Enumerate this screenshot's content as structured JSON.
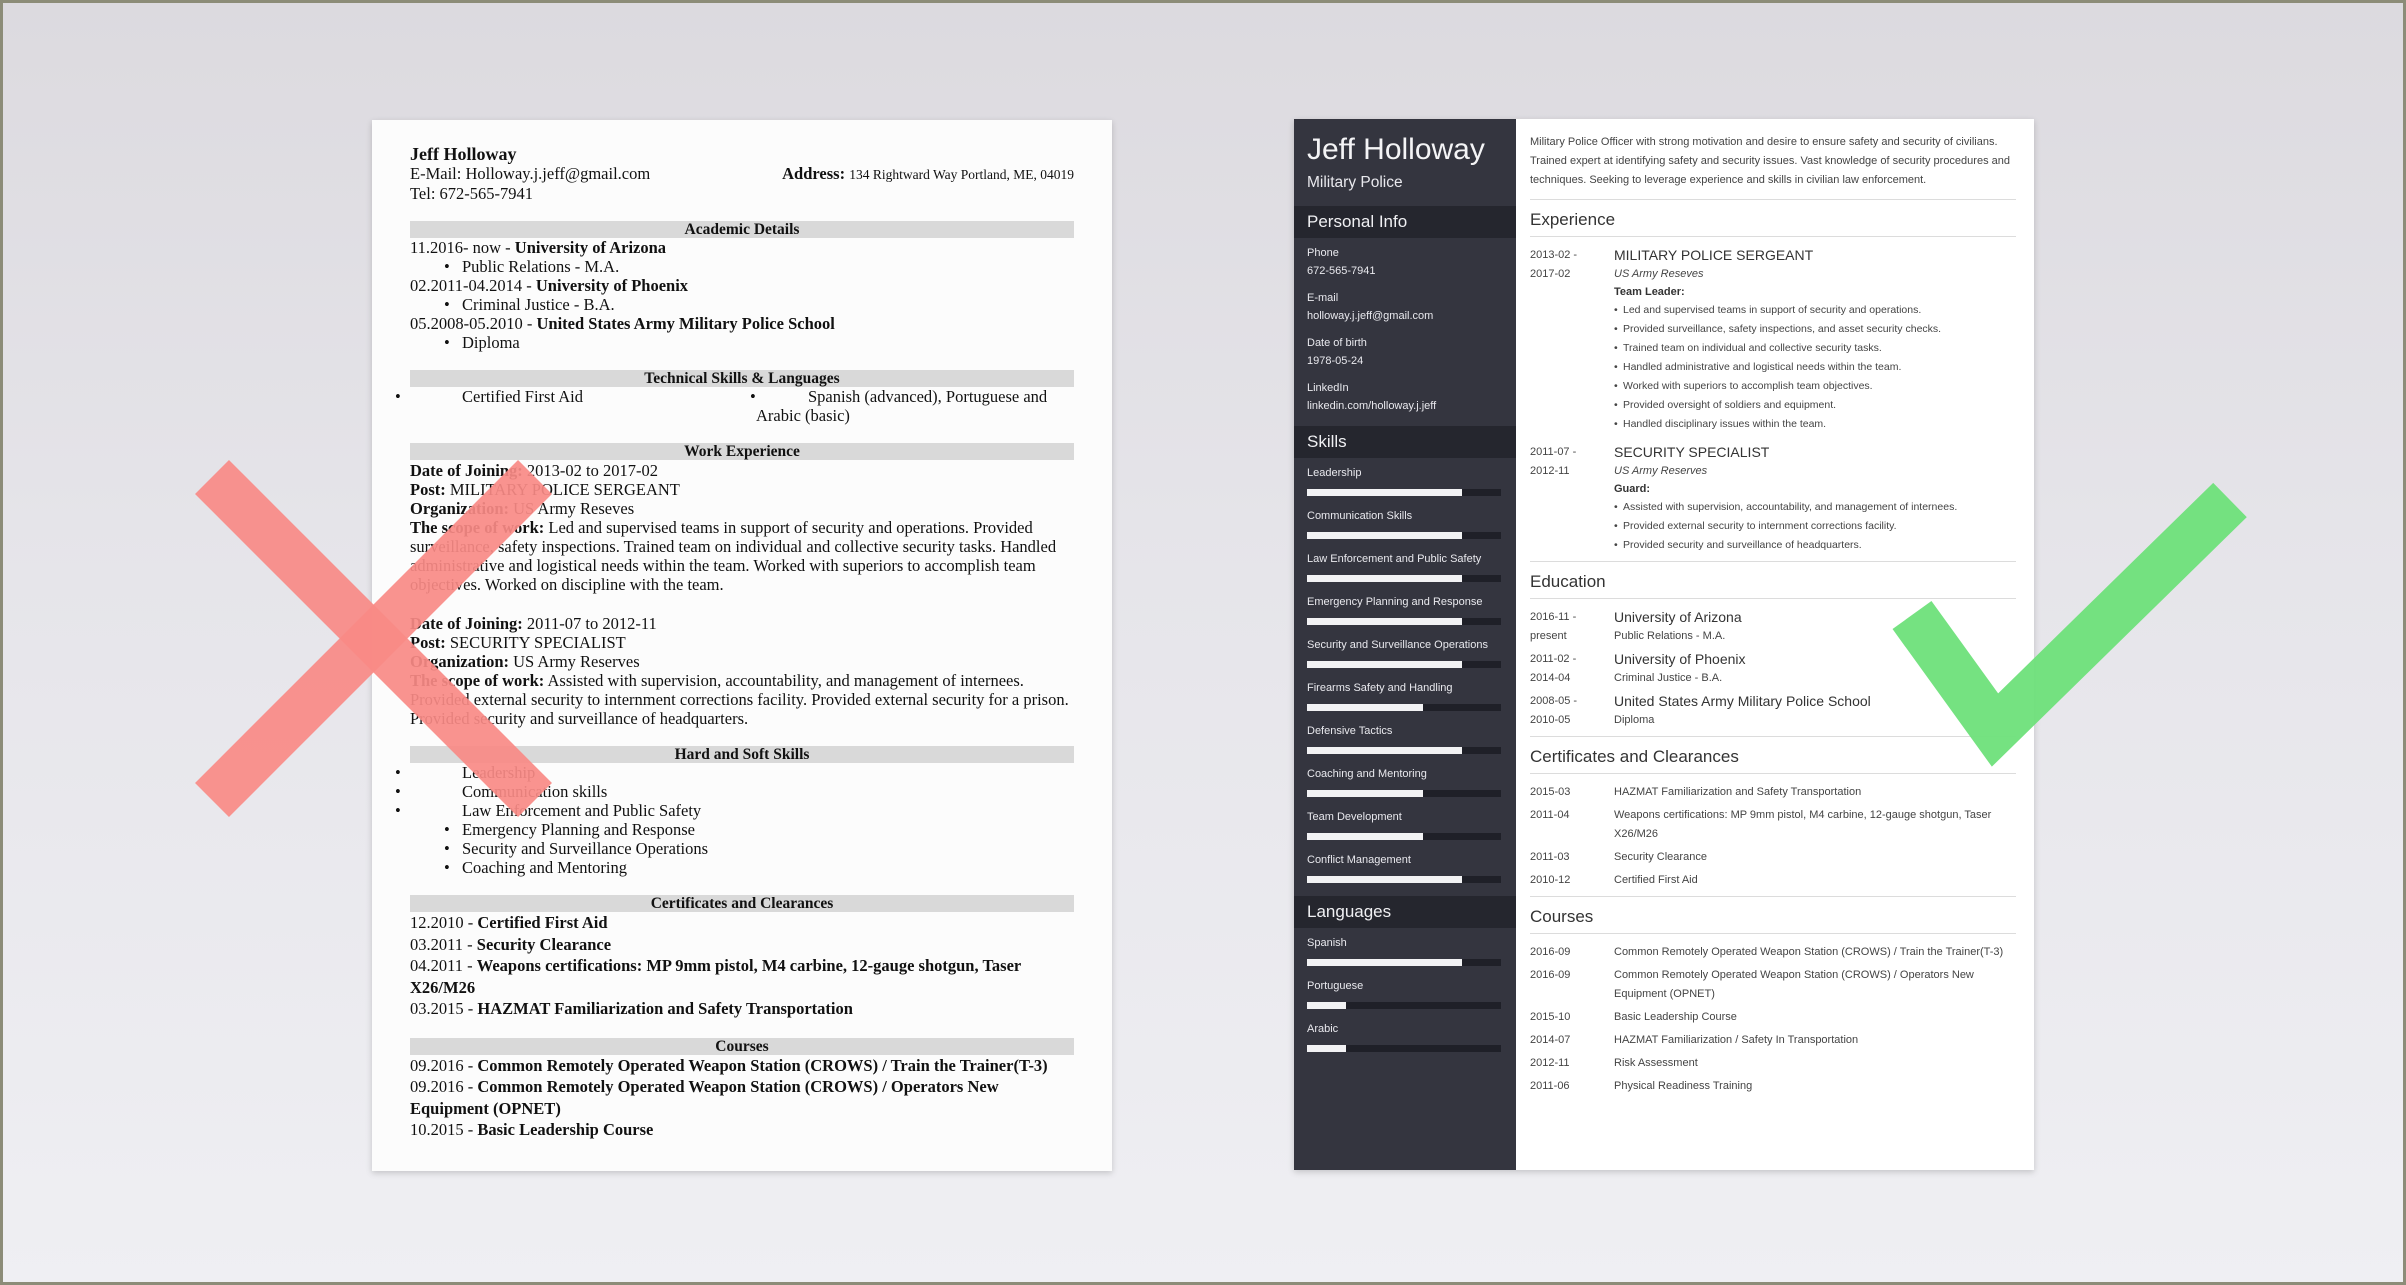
{
  "bad_resume": {
    "name": "Jeff Holloway",
    "email_line": "E-Mail: Holloway.j.jeff@gmail.com",
    "address_label": "Address:",
    "address_value": "134 Rightward Way Portland, ME, 04019",
    "tel_line": "Tel: 672-565-7941",
    "sections": {
      "academic": "Academic Details",
      "technical": "Technical Skills & Languages",
      "work": "Work Experience",
      "skills": "Hard and Soft Skills",
      "certificates": "Certificates and Clearances",
      "courses": "Courses"
    },
    "academic": [
      {
        "date": " 11.2016- now - ",
        "school": "University of Arizona",
        "degree": "Public Relations - M.A."
      },
      {
        "date": "02.2011-04.2014 - ",
        "school": "University of Phoenix",
        "degree": "Criminal Justice - B.A."
      },
      {
        "date": "05.2008-05.2010 - ",
        "school": "United States Army Military Police School",
        "degree": "Diploma"
      }
    ],
    "technical": [
      "Certified First Aid",
      "Spanish (advanced), Portuguese and Arabic (basic)"
    ],
    "labels": {
      "joining": "Date of Joining:",
      "post": "Post:",
      "organization": "Organization:",
      "scope": "The scope of work:"
    },
    "jobs": [
      {
        "dates": " 2013-02 to 2017-02",
        "post": " MILITARY POLICE SERGEANT",
        "organization": " US Army Reseves",
        "scope": " Led and supervised teams in support of security and operations. Provided surveillance, safety inspections. Trained team on individual and collective security tasks. Handled administrative and logistical needs within the team. Worked with superiors to accomplish team objectives. Worked on discipline with the team."
      },
      {
        "dates": " 2011-07 to 2012-11",
        "post": " SECURITY SPECIALIST",
        "organization": " US Army Reserves",
        "scope": " Assisted with supervision, accountability, and management of internees. Provided external security to internment corrections facility. Provided external security for a prison. Provided security and surveillance of headquarters."
      }
    ],
    "skills_far": [
      "Leadership",
      "Communication skills",
      "Law Enforcement and Public Safety"
    ],
    "skills_near": [
      "Emergency Planning and Response",
      "Security and Surveillance Operations",
      "Coaching and Mentoring"
    ],
    "certificates": [
      {
        "date": "12.2010 - ",
        "name": "Certified First Aid"
      },
      {
        "date": "03.2011 - ",
        "name": "Security Clearance"
      },
      {
        "date": "04.2011 - ",
        "name": "Weapons certifications: MP 9mm pistol, M4 carbine, 12-gauge shotgun, Taser X26/M26"
      },
      {
        "date": "03.2015 - ",
        "name": "HAZMAT Familiarization and Safety Transportation"
      }
    ],
    "courses": [
      {
        "date": "09.2016 - ",
        "name": "Common Remotely Operated Weapon Station (CROWS) / Train the Trainer(T-3)"
      },
      {
        "date": "09.2016 - ",
        "name": "Common Remotely Operated Weapon Station (CROWS) / Operators New Equipment (OPNET)"
      },
      {
        "date": "10.2015 - ",
        "name": "Basic Leadership Course"
      }
    ]
  },
  "good_resume": {
    "name": "Jeff Holloway",
    "role": "Military Police",
    "sidebar_sections": {
      "personal": "Personal Info",
      "skills": "Skills",
      "languages": "Languages"
    },
    "personal": [
      {
        "label": "Phone",
        "value": "672-565-7941"
      },
      {
        "label": "E-mail",
        "value": "holloway.j.jeff@gmail.com"
      },
      {
        "label": "Date of birth",
        "value": "1978-05-24"
      },
      {
        "label": "LinkedIn",
        "value": "linkedin.com/holloway.j.jeff"
      }
    ],
    "skills": [
      {
        "name": "Leadership",
        "level": 0.8
      },
      {
        "name": "Communication Skills",
        "level": 0.8
      },
      {
        "name": "Law Enforcement and Public Safety",
        "level": 0.8
      },
      {
        "name": "Emergency Planning and Response",
        "level": 0.8
      },
      {
        "name": "Security and Surveillance Operations",
        "level": 0.8
      },
      {
        "name": "Firearms Safety and Handling",
        "level": 0.6
      },
      {
        "name": "Defensive Tactics",
        "level": 0.8
      },
      {
        "name": "Coaching and Mentoring",
        "level": 0.6
      },
      {
        "name": "Team Development",
        "level": 0.6
      },
      {
        "name": "Conflict Management",
        "level": 0.8
      }
    ],
    "languages": [
      {
        "name": "Spanish",
        "level": 0.8
      },
      {
        "name": "Portuguese",
        "level": 0.2
      },
      {
        "name": "Arabic",
        "level": 0.2
      }
    ],
    "summary": "Military Police Officer with strong motivation and desire to ensure safety and security of civilians. Trained expert at identifying safety and security issues. Vast knowledge of security procedures and techniques. Seeking to leverage experience and skills in civilian law enforcement.",
    "main_sections": {
      "experience": "Experience",
      "education": "Education",
      "certificates": "Certificates and Clearances",
      "courses": "Courses"
    },
    "experience": [
      {
        "date_from": "2013-02 -",
        "date_to": "2017-02",
        "title": "MILITARY POLICE SERGEANT",
        "org": "US Army Reseves",
        "role": "Team Leader:",
        "bullets": [
          "Led and supervised teams in support of security and operations.",
          "Provided surveillance, safety inspections, and asset security checks.",
          "Trained team on individual and collective security tasks.",
          "Handled administrative and logistical needs within the team.",
          "Worked with superiors to accomplish team objectives.",
          "Provided oversight of soldiers and equipment.",
          "Handled disciplinary issues within the team."
        ]
      },
      {
        "date_from": "2011-07 -",
        "date_to": "2012-11",
        "title": "SECURITY SPECIALIST",
        "org": "US Army Reserves",
        "role": "Guard:",
        "bullets": [
          "Assisted with supervision, accountability, and management of internees.",
          "Provided external security to internment corrections facility.",
          "Provided security and surveillance of headquarters."
        ]
      }
    ],
    "education": [
      {
        "date_from": "2016-11 -",
        "date_to": "present",
        "school": "University of Arizona",
        "degree": "Public Relations - M.A."
      },
      {
        "date_from": "2011-02 -",
        "date_to": "2014-04",
        "school": "University of Phoenix",
        "degree": "Criminal Justice - B.A."
      },
      {
        "date_from": "2008-05 -",
        "date_to": "2010-05",
        "school": "United States Army Military Police School",
        "degree": "Diploma"
      }
    ],
    "certificates": [
      {
        "date": "2015-03",
        "name": "HAZMAT Familiarization and Safety Transportation"
      },
      {
        "date": "2011-04",
        "name": "Weapons certifications: MP 9mm pistol, M4 carbine, 12-gauge shotgun, Taser X26/M26"
      },
      {
        "date": "2011-03",
        "name": "Security Clearance"
      },
      {
        "date": "2010-12",
        "name": "Certified First Aid"
      }
    ],
    "courses": [
      {
        "date": "2016-09",
        "name": "Common Remotely Operated Weapon Station (CROWS) / Train the Trainer(T-3)"
      },
      {
        "date": "2016-09",
        "name": "Common Remotely Operated Weapon Station (CROWS) / Operators New Equipment (OPNET)"
      },
      {
        "date": "2015-10",
        "name": "Basic Leadership Course"
      },
      {
        "date": "2014-07",
        "name": "HAZMAT Familiarization / Safety In Transportation"
      },
      {
        "date": "2012-11",
        "name": "Risk Assessment"
      },
      {
        "date": "2011-06",
        "name": "Physical Readiness Training"
      }
    ]
  },
  "colors": {
    "x_mark": "#f88a86",
    "check_mark": "#6ee07a",
    "sidebar_bg": "#34353f",
    "sidebar_band": "#25262e",
    "section_band_bad": "#d9d9d9"
  }
}
